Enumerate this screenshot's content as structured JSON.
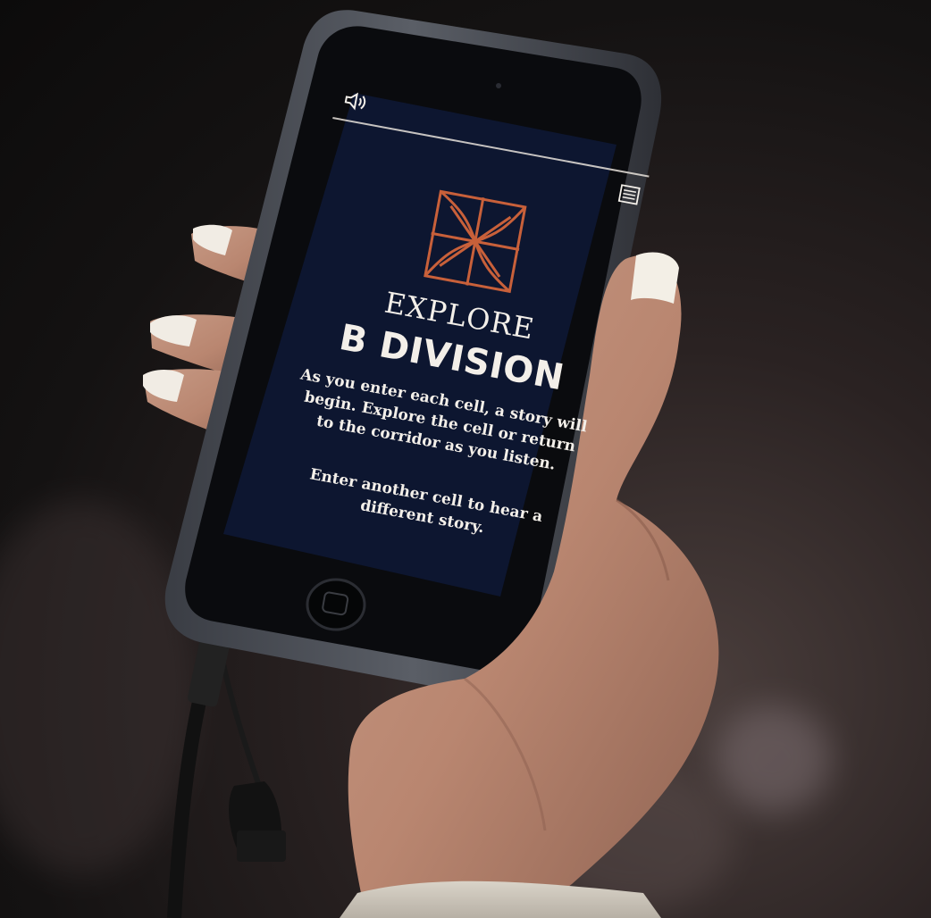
{
  "screen": {
    "icons": {
      "sound": "speaker-icon",
      "menu": "list-icon"
    },
    "heading_small": "EXPLORE",
    "heading_large": "B DIVISION",
    "intro": "As you enter each cell, a story will begin. Explore the cell or return to the corridor as you listen.",
    "hint": "Enter another cell to hear a different story.",
    "colors": {
      "background": "#0d1630",
      "text": "#f3efe9",
      "logo_accent": "#c8603a"
    }
  }
}
